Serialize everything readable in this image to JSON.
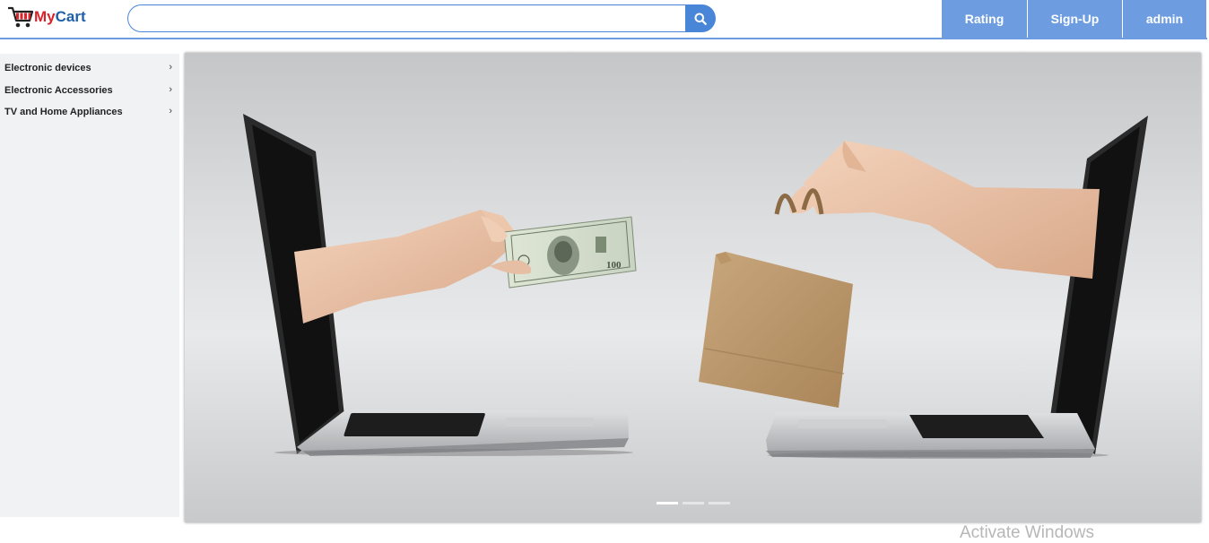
{
  "logo": {
    "part1": "My",
    "part2": "Cart",
    "icon": "shopping-cart-icon"
  },
  "search": {
    "placeholder": "",
    "value": "",
    "button_icon": "search-icon"
  },
  "nav": [
    {
      "label": "Rating"
    },
    {
      "label": "Sign-Up"
    },
    {
      "label": "admin"
    }
  ],
  "sidebar": {
    "items": [
      {
        "label": "Electronic devices",
        "icon": "chevron-right-icon"
      },
      {
        "label": "Electronic Accessories",
        "icon": "chevron-right-icon"
      },
      {
        "label": "TV and Home Appliances",
        "icon": "chevron-right-icon"
      }
    ]
  },
  "carousel": {
    "slides_count": 3,
    "active_index": 0,
    "banner_note": {
      "money": "100"
    }
  },
  "watermark": {
    "text": "Activate Windows"
  },
  "colors": {
    "accent": "#6d9de0",
    "search_border": "#4a86d8",
    "logo_red": "#d8232a",
    "logo_blue": "#1f5fa8"
  }
}
